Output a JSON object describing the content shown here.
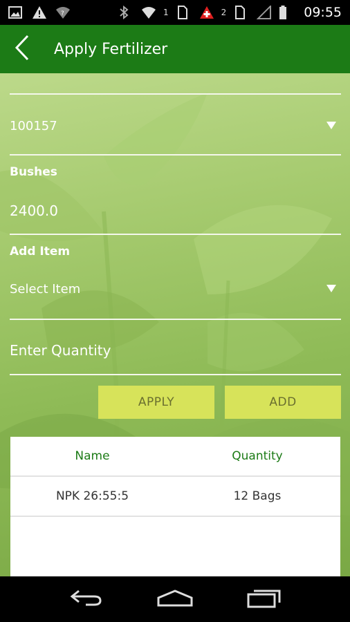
{
  "status_bar": {
    "sim1_indicator": "1",
    "sim2_indicator": "2",
    "time": "09:55"
  },
  "app_bar": {
    "title": "Apply Fertilizer"
  },
  "form": {
    "selector_value": "100157",
    "bushes_label": "Bushes",
    "bushes_value": "2400.0",
    "add_item_label": "Add Item",
    "item_select_value": "Select Item",
    "quantity_placeholder": "Enter Quantity",
    "apply_button": "APPLY",
    "add_button": "ADD"
  },
  "table": {
    "headers": [
      "Name",
      "Quantity"
    ],
    "rows": [
      {
        "name": "NPK 26:55:5",
        "quantity": "12 Bags"
      }
    ]
  },
  "colors": {
    "app_bar": "#1c7b16",
    "header_text": "#1c7b16",
    "button_bg": "#d7e35a",
    "button_text": "#6a6f2f"
  },
  "icons": {
    "back": "chevron-left-icon",
    "dropdown": "triangle-down-icon",
    "nav_back": "back-arrow-icon",
    "nav_home": "home-icon",
    "nav_recents": "recents-icon"
  }
}
